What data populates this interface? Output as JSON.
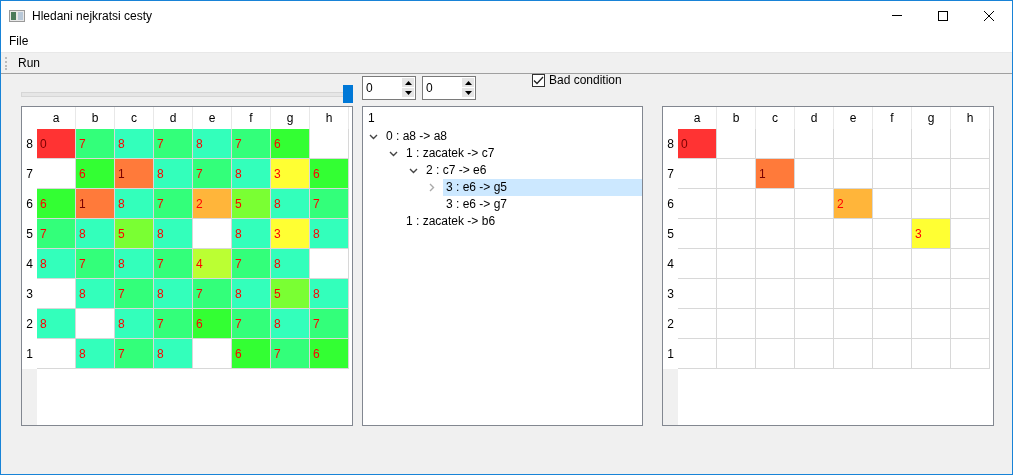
{
  "window": {
    "title": "Hledani nejkratsi cesty"
  },
  "menu": [
    "File"
  ],
  "toolbar": [
    "Run"
  ],
  "slider": {
    "level": 1
  },
  "spinboxes": [
    {
      "value": "0"
    },
    {
      "value": "0"
    }
  ],
  "bad_condition": {
    "label": "Bad condition",
    "checked": true
  },
  "left_board": {
    "columns": [
      "a",
      "b",
      "c",
      "d",
      "e",
      "f",
      "g",
      "h"
    ],
    "rows": [
      {
        "label": "8",
        "cells": [
          {
            "value": "0",
            "color": "#ff3333"
          },
          {
            "value": "7",
            "color": "#33ff7a"
          },
          {
            "value": "8",
            "color": "#33ffbb"
          },
          {
            "value": "7",
            "color": "#33ff7a"
          },
          {
            "value": "8",
            "color": "#33ffbb"
          },
          {
            "value": "7",
            "color": "#33ff7a"
          },
          {
            "value": "6",
            "color": "#33ff33"
          },
          {}
        ]
      },
      {
        "label": "7",
        "cells": [
          {},
          {
            "value": "6",
            "color": "#33ff33"
          },
          {
            "value": "1",
            "color": "#ff7a3a"
          },
          {
            "value": "8",
            "color": "#33ffbb"
          },
          {
            "value": "7",
            "color": "#33ff7a"
          },
          {
            "value": "8",
            "color": "#33ffbb"
          },
          {
            "value": "3",
            "color": "#ffff33"
          },
          {
            "value": "6",
            "color": "#33ff33"
          }
        ]
      },
      {
        "label": "6",
        "cells": [
          {
            "value": "6",
            "color": "#33ff33"
          },
          {
            "value": "1",
            "color": "#ff7a3a"
          },
          {
            "value": "8",
            "color": "#33ffbb"
          },
          {
            "value": "7",
            "color": "#33ff7a"
          },
          {
            "value": "2",
            "color": "#ffb53a"
          },
          {
            "value": "5",
            "color": "#7aff33"
          },
          {
            "value": "8",
            "color": "#33ffbb"
          },
          {
            "value": "7",
            "color": "#33ff7a"
          }
        ]
      },
      {
        "label": "5",
        "cells": [
          {
            "value": "7",
            "color": "#33ff7a"
          },
          {
            "value": "8",
            "color": "#33ffbb"
          },
          {
            "value": "5",
            "color": "#7aff33"
          },
          {
            "value": "8",
            "color": "#33ffbb"
          },
          {},
          {
            "value": "8",
            "color": "#33ffbb"
          },
          {
            "value": "3",
            "color": "#ffff33"
          },
          {
            "value": "8",
            "color": "#33ffbb"
          }
        ]
      },
      {
        "label": "4",
        "cells": [
          {
            "value": "8",
            "color": "#33ffbb"
          },
          {
            "value": "7",
            "color": "#33ff7a"
          },
          {
            "value": "8",
            "color": "#33ffbb"
          },
          {
            "value": "7",
            "color": "#33ff7a"
          },
          {
            "value": "4",
            "color": "#bbff33"
          },
          {
            "value": "7",
            "color": "#33ff7a"
          },
          {
            "value": "8",
            "color": "#33ffbb"
          },
          {}
        ]
      },
      {
        "label": "3",
        "cells": [
          {},
          {
            "value": "8",
            "color": "#33ffbb"
          },
          {
            "value": "7",
            "color": "#33ff7a"
          },
          {
            "value": "8",
            "color": "#33ffbb"
          },
          {
            "value": "7",
            "color": "#33ff7a"
          },
          {
            "value": "8",
            "color": "#33ffbb"
          },
          {
            "value": "5",
            "color": "#7aff33"
          },
          {
            "value": "8",
            "color": "#33ffbb"
          }
        ]
      },
      {
        "label": "2",
        "cells": [
          {
            "value": "8",
            "color": "#33ffbb"
          },
          {},
          {
            "value": "8",
            "color": "#33ffbb"
          },
          {
            "value": "7",
            "color": "#33ff7a"
          },
          {
            "value": "6",
            "color": "#33ff33"
          },
          {
            "value": "7",
            "color": "#33ff7a"
          },
          {
            "value": "8",
            "color": "#33ffbb"
          },
          {
            "value": "7",
            "color": "#33ff7a"
          }
        ]
      },
      {
        "label": "1",
        "cells": [
          {},
          {
            "value": "8",
            "color": "#33ffbb"
          },
          {
            "value": "7",
            "color": "#33ff7a"
          },
          {
            "value": "8",
            "color": "#33ffbb"
          },
          {},
          {
            "value": "6",
            "color": "#33ff33"
          },
          {
            "value": "7",
            "color": "#33ff7a"
          },
          {
            "value": "6",
            "color": "#33ff33"
          }
        ]
      }
    ]
  },
  "tree": {
    "header": "1",
    "items": [
      {
        "label": "0 : a8 -> a8",
        "kind": "branch",
        "expanded": true,
        "selected": false,
        "children": [
          {
            "label": "1 : zacatek -> c7",
            "kind": "branch",
            "expanded": true,
            "selected": false,
            "children": [
              {
                "label": "2 : c7 -> e6",
                "kind": "branch",
                "expanded": true,
                "selected": false,
                "children": [
                  {
                    "label": "3 : e6 -> g5",
                    "kind": "branch",
                    "expanded": false,
                    "selected": true
                  },
                  {
                    "label": "3 : e6 -> g7",
                    "kind": "leaf",
                    "selected": false
                  }
                ]
              }
            ]
          },
          {
            "label": "1 : zacatek -> b6",
            "kind": "leaf",
            "selected": false
          }
        ]
      }
    ]
  },
  "right_board": {
    "columns": [
      "a",
      "b",
      "c",
      "d",
      "e",
      "f",
      "g",
      "h"
    ],
    "rows": [
      {
        "label": "8",
        "cells": [
          {
            "value": "0",
            "color": "#ff3333"
          },
          {},
          {},
          {},
          {},
          {},
          {},
          {}
        ]
      },
      {
        "label": "7",
        "cells": [
          {},
          {},
          {
            "value": "1",
            "color": "#ff7a3a"
          },
          {},
          {},
          {},
          {},
          {}
        ]
      },
      {
        "label": "6",
        "cells": [
          {},
          {},
          {},
          {},
          {
            "value": "2",
            "color": "#ffb53a"
          },
          {},
          {},
          {}
        ]
      },
      {
        "label": "5",
        "cells": [
          {},
          {},
          {},
          {},
          {},
          {},
          {
            "value": "3",
            "color": "#ffff33"
          },
          {}
        ]
      },
      {
        "label": "4",
        "cells": [
          {},
          {},
          {},
          {},
          {},
          {},
          {},
          {}
        ]
      },
      {
        "label": "3",
        "cells": [
          {},
          {},
          {},
          {},
          {},
          {},
          {},
          {}
        ]
      },
      {
        "label": "2",
        "cells": [
          {},
          {},
          {},
          {},
          {},
          {},
          {},
          {}
        ]
      },
      {
        "label": "1",
        "cells": [
          {},
          {},
          {},
          {},
          {},
          {},
          {},
          {}
        ]
      }
    ]
  }
}
